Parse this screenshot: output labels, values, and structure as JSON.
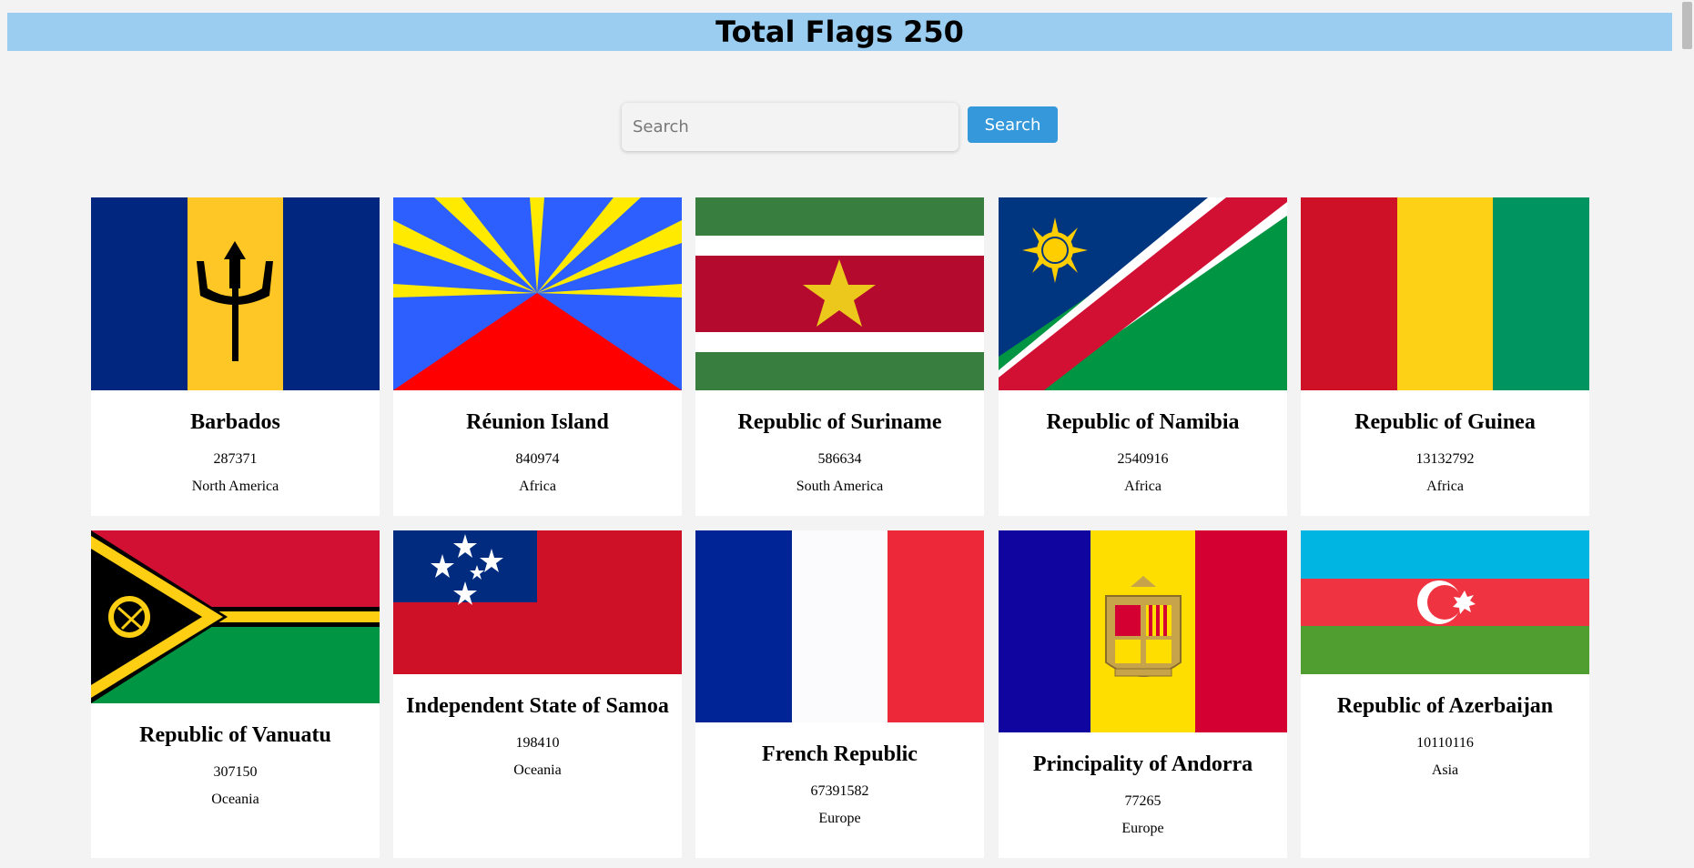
{
  "header": {
    "title": "Total Flags 250"
  },
  "search": {
    "placeholder": "Search",
    "value": "",
    "button_label": "Search"
  },
  "countries": [
    {
      "name": "Barbados",
      "population": "287371",
      "region": "North America",
      "flag": "barbados-flag"
    },
    {
      "name": "Réunion Island",
      "population": "840974",
      "region": "Africa",
      "flag": "reunion-flag"
    },
    {
      "name": "Republic of Suriname",
      "population": "586634",
      "region": "South America",
      "flag": "suriname-flag"
    },
    {
      "name": "Republic of Namibia",
      "population": "2540916",
      "region": "Africa",
      "flag": "namibia-flag"
    },
    {
      "name": "Republic of Guinea",
      "population": "13132792",
      "region": "Africa",
      "flag": "guinea-flag"
    },
    {
      "name": "Republic of Vanuatu",
      "population": "307150",
      "region": "Oceania",
      "flag": "vanuatu-flag"
    },
    {
      "name": "Independent State of Samoa",
      "population": "198410",
      "region": "Oceania",
      "flag": "samoa-flag"
    },
    {
      "name": "French Republic",
      "population": "67391582",
      "region": "Europe",
      "flag": "france-flag"
    },
    {
      "name": "Principality of Andorra",
      "population": "77265",
      "region": "Europe",
      "flag": "andorra-flag"
    },
    {
      "name": "Republic of Azerbaijan",
      "population": "10110116",
      "region": "Asia",
      "flag": "azerbaijan-flag"
    }
  ],
  "colors": {
    "header_bg": "#9acdef",
    "button_bg": "#3498db",
    "page_bg": "#f3f3f3"
  }
}
